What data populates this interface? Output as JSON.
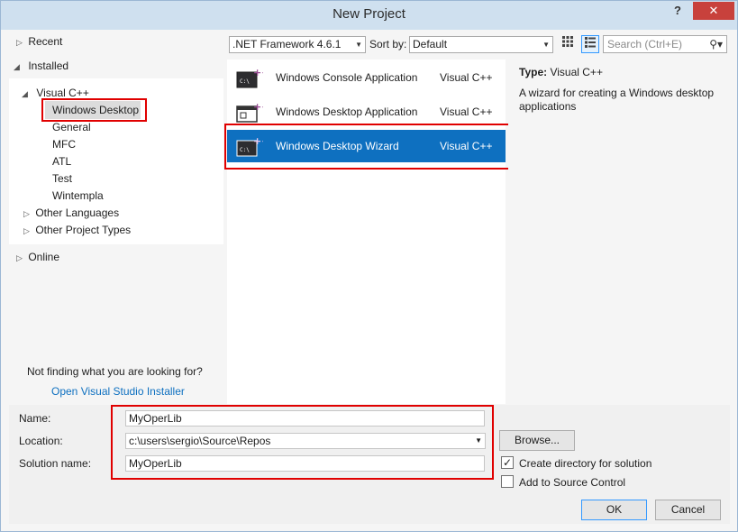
{
  "window": {
    "title": "New Project",
    "help_label": "?",
    "close_label": "✕"
  },
  "tree": {
    "recent": "Recent",
    "installed": "Installed",
    "visual_cpp": "Visual C++",
    "items": [
      "Windows Desktop",
      "General",
      "MFC",
      "ATL",
      "Test",
      "Wintempla"
    ],
    "other_languages": "Other Languages",
    "other_project_types": "Other Project Types",
    "online": "Online",
    "not_finding": "Not finding what you are looking for?",
    "installer_link": "Open Visual Studio Installer"
  },
  "toolbar": {
    "framework": ".NET Framework 4.6.1",
    "sort_label": "Sort by:",
    "sort_value": "Default",
    "search_placeholder": "Search (Ctrl+E)"
  },
  "templates": [
    {
      "name": "Windows Console Application",
      "lang": "Visual C++"
    },
    {
      "name": "Windows Desktop Application",
      "lang": "Visual C++"
    },
    {
      "name": "Windows Desktop Wizard",
      "lang": "Visual C++"
    }
  ],
  "description": {
    "type_label": "Type:",
    "type_value": "Visual C++",
    "text": "A wizard for creating a Windows desktop applications"
  },
  "form": {
    "name_label": "Name:",
    "name_value": "MyOperLib",
    "location_label": "Location:",
    "location_value": "c:\\users\\sergio\\Source\\Repos",
    "solution_label": "Solution name:",
    "solution_value": "MyOperLib",
    "browse_label": "Browse...",
    "create_dir_label": "Create directory for solution",
    "create_dir_checked": true,
    "source_control_label": "Add to Source Control",
    "source_control_checked": false,
    "ok_label": "OK",
    "cancel_label": "Cancel"
  },
  "colors": {
    "selection": "#0e70c0",
    "highlight_box": "#e00000",
    "link": "#0e70c0"
  }
}
